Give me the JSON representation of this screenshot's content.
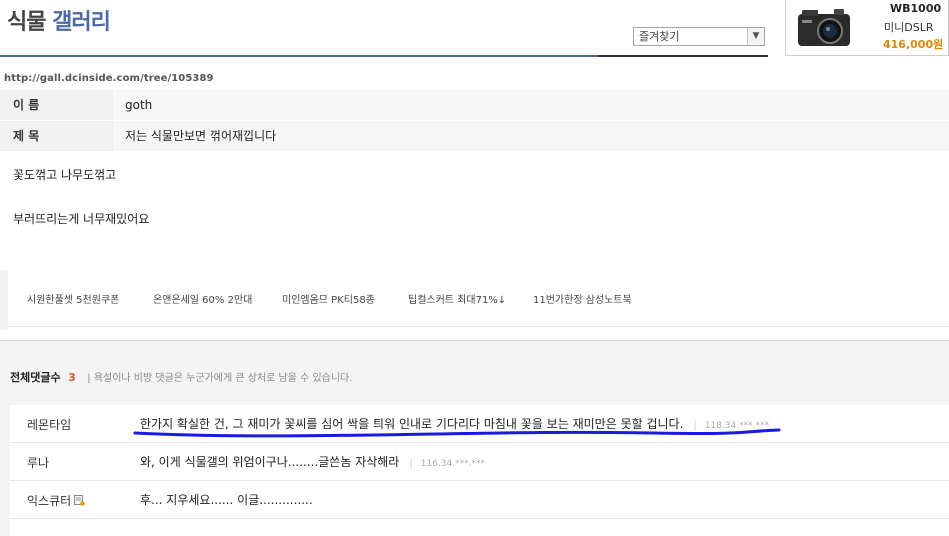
{
  "header": {
    "title_part1": "식물",
    "title_part2": "갤러리",
    "favorites_select": "즐겨찾기"
  },
  "ad": {
    "model": "WB1000",
    "type": "미니DSLR",
    "price": "416,000원"
  },
  "post": {
    "url": "http://gall.dcinside.com/tree/105389",
    "name_label": "이 름",
    "name_value": "goth",
    "subject_label": "제 목",
    "subject_value": "저는 식물만보면 꺾어재낍니다",
    "content_lines": [
      "꽃도꺾고 나무도꺾고",
      "부러뜨리는게 너무재밌어요"
    ]
  },
  "ad_links": [
    "시원한풀셋 5천원쿠폰",
    "온앤온세일 60% 2만대",
    "미인엠옴므 PK티58종",
    "팁컬스커트 최대71%↓",
    "11번가한정 삼성노트북"
  ],
  "comments_section": {
    "title": "전체댓글수",
    "count": "3",
    "notice": "| 욕설이나 비방 댓글은 누군가에게 큰 상처로 남을 수 있습니다."
  },
  "comments": [
    {
      "author": "레몬타임",
      "body": "한가지 확실한 건, 그 재미가 꽃씨를 심어 싹을 틔워 인내로 기다리다 마침내 꽃을 보는 재미만은 못할 겁니다.",
      "ip": "118.34.***.***"
    },
    {
      "author": "루나",
      "body": "와, 이게 식물갤의 위엄이구나........글쓴놈 자삭해라",
      "ip": "116.34.***.***"
    },
    {
      "author": "익스큐터",
      "body": "후... 지우세요...... 이글..............",
      "ip": ""
    }
  ],
  "colors": {
    "title_blue": "#4b6aa8",
    "price_orange": "#d98a00",
    "count_red": "#e0572a",
    "annotation_blue": "#1a1ae0"
  }
}
